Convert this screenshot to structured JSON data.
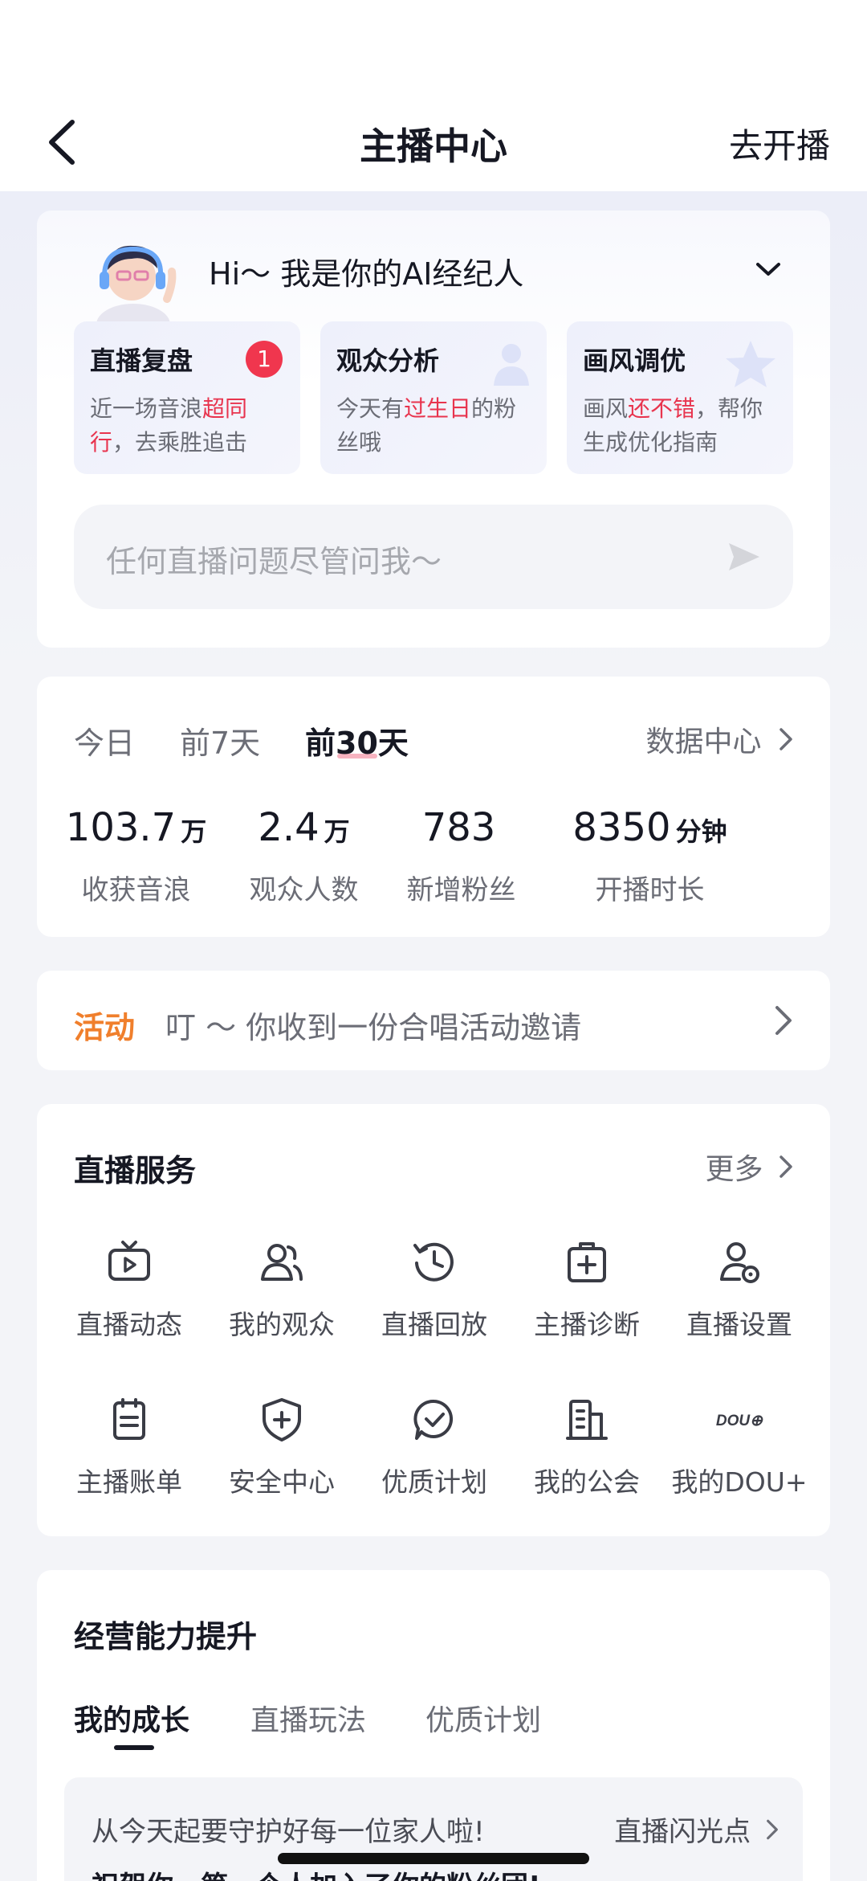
{
  "nav": {
    "title": "主播中心",
    "action": "去开播"
  },
  "ai": {
    "greeting": "Hi～ 我是你的AI经纪人",
    "tips": [
      {
        "title": "直播复盘",
        "badge": "1",
        "text_a": "近一场音浪",
        "highlight": "超同行",
        "text_b": "，去乘胜追击"
      },
      {
        "title": "观众分析",
        "text_a": "今天有",
        "highlight": "过生日",
        "text_b": "的粉丝哦"
      },
      {
        "title": "画风调优",
        "text_a": "画风",
        "highlight": "还不错",
        "text_b": "，帮你生成优化指南"
      }
    ],
    "ask_placeholder": "任何直播问题尽管问我～"
  },
  "stats": {
    "tabs": [
      "今日",
      "前7天",
      "前30天"
    ],
    "active_tab": "前30天",
    "link": "数据中心",
    "items": [
      {
        "value": "103.7",
        "unit": "万",
        "label": "收获音浪"
      },
      {
        "value": "2.4",
        "unit": "万",
        "label": "观众人数"
      },
      {
        "value": "783",
        "unit": "",
        "label": "新增粉丝"
      },
      {
        "value": "8350",
        "unit": "分钟",
        "label": "开播时长"
      }
    ]
  },
  "activity": {
    "tag": "活动",
    "text": "叮 ～ 你收到一份合唱活动邀请"
  },
  "services": {
    "title": "直播服务",
    "more": "更多",
    "items": [
      {
        "label": "直播动态",
        "icon": "tv-icon"
      },
      {
        "label": "我的观众",
        "icon": "audience-icon"
      },
      {
        "label": "直播回放",
        "icon": "replay-icon"
      },
      {
        "label": "主播诊断",
        "icon": "diagnosis-icon"
      },
      {
        "label": "直播设置",
        "icon": "settings-user-icon"
      },
      {
        "label": "主播账单",
        "icon": "bill-icon"
      },
      {
        "label": "安全中心",
        "icon": "shield-icon"
      },
      {
        "label": "优质计划",
        "icon": "check-chat-icon"
      },
      {
        "label": "我的公会",
        "icon": "building-icon"
      },
      {
        "label": "我的DOU+",
        "icon": "dou-plus-icon",
        "glyph": "DOU⊕"
      }
    ]
  },
  "growth": {
    "title": "经营能力提升",
    "tabs": [
      "我的成长",
      "直播玩法",
      "优质计划"
    ],
    "active_tab": "我的成长",
    "line1": "从今天起要守护好每一位家人啦!",
    "link": "直播闪光点",
    "line2": "祝贺你，第一个人加入了你的粉丝团!"
  },
  "colors": {
    "accent_red": "#f0364e",
    "activity_orange": "#f07f2c",
    "text_primary": "#161823",
    "text_secondary": "#6b6d76"
  }
}
